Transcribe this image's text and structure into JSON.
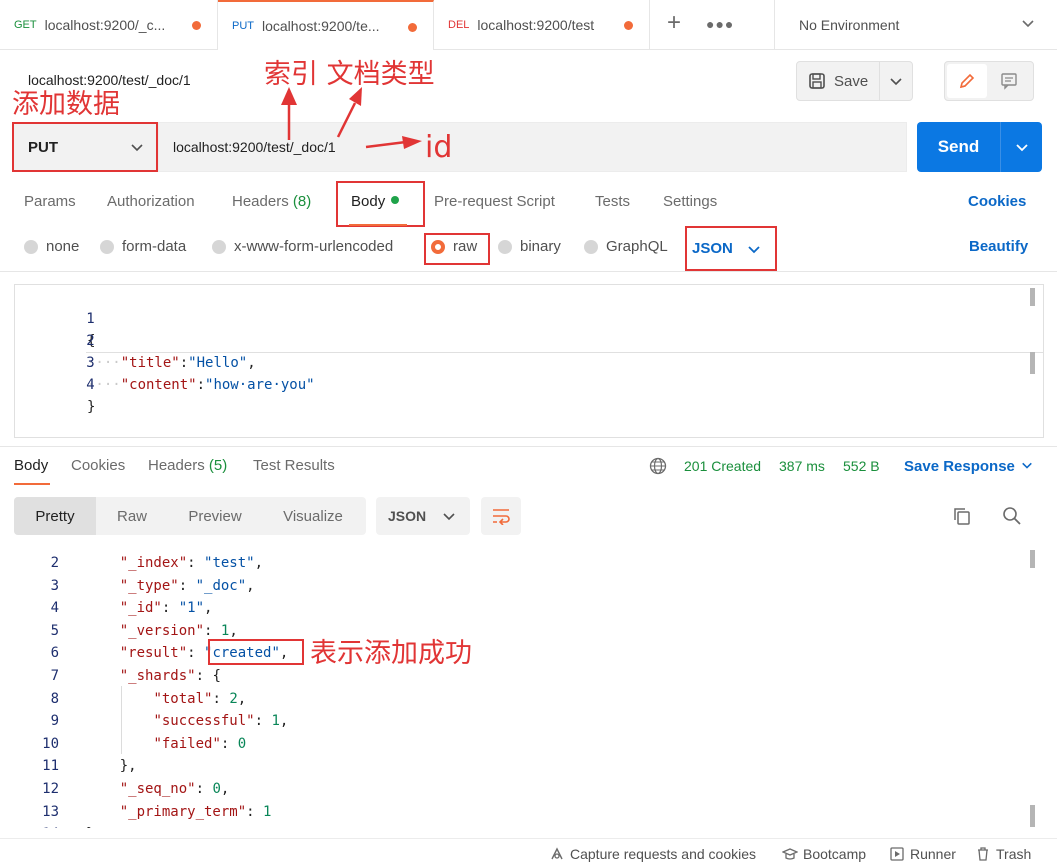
{
  "tabs": [
    {
      "method": "GET",
      "method_color": "#1a8f3c",
      "label": "localhost:9200/_c...",
      "unsaved": true
    },
    {
      "method": "PUT",
      "method_color": "#0b68c7",
      "label": "localhost:9200/te...",
      "unsaved": true,
      "active": true
    },
    {
      "method": "DEL",
      "method_color": "#e13535",
      "label": "localhost:9200/test",
      "unsaved": true
    }
  ],
  "environment": "No Environment",
  "request": {
    "title": "localhost:9200/test/_doc/1",
    "method": "PUT",
    "url": "localhost:9200/test/_doc/1",
    "save_label": "Save",
    "send_label": "Send"
  },
  "request_tabs": {
    "params": "Params",
    "authorization": "Authorization",
    "headers": "Headers",
    "headers_count": "(8)",
    "body": "Body",
    "pre_request": "Pre-request Script",
    "tests": "Tests",
    "settings": "Settings",
    "cookies": "Cookies"
  },
  "body_types": {
    "none": "none",
    "form_data": "form-data",
    "urlencoded": "x-www-form-urlencoded",
    "raw": "raw",
    "binary": "binary",
    "graphql": "GraphQL",
    "format": "JSON",
    "beautify": "Beautify"
  },
  "request_body_lines": [
    {
      "n": "1",
      "text": "{"
    },
    {
      "n": "2",
      "indent": "····",
      "key": "\"title\"",
      "sep": ":",
      "value": "\"Hello\"",
      "tail": ","
    },
    {
      "n": "3",
      "indent": "····",
      "key": "\"content\"",
      "sep": ":",
      "value": "\"how·are·you\"",
      "tail": ""
    },
    {
      "n": "4",
      "text": "}"
    }
  ],
  "response_tabs": {
    "body": "Body",
    "cookies": "Cookies",
    "headers": "Headers",
    "headers_count": "(5)",
    "test_results": "Test Results"
  },
  "response_status": {
    "status": "201 Created",
    "time": "387 ms",
    "size": "552 B",
    "save_response": "Save Response"
  },
  "response_views": {
    "pretty": "Pretty",
    "raw": "Raw",
    "preview": "Preview",
    "visualize": "Visualize",
    "format": "JSON"
  },
  "response_body_lines": [
    {
      "n": "2",
      "pre": "    ",
      "key": "\"_index\"",
      "sep": ": ",
      "value": "\"test\"",
      "vtype": "str",
      "tail": ","
    },
    {
      "n": "3",
      "pre": "    ",
      "key": "\"_type\"",
      "sep": ": ",
      "value": "\"_doc\"",
      "vtype": "str",
      "tail": ","
    },
    {
      "n": "4",
      "pre": "    ",
      "key": "\"_id\"",
      "sep": ": ",
      "value": "\"1\"",
      "vtype": "str",
      "tail": ","
    },
    {
      "n": "5",
      "pre": "    ",
      "key": "\"_version\"",
      "sep": ": ",
      "value": "1",
      "vtype": "num",
      "tail": ","
    },
    {
      "n": "6",
      "pre": "    ",
      "key": "\"result\"",
      "sep": ": ",
      "value": "\"created\"",
      "vtype": "str",
      "tail": ","
    },
    {
      "n": "7",
      "pre": "    ",
      "key": "\"_shards\"",
      "sep": ": ",
      "value": "{",
      "vtype": "plain",
      "tail": ""
    },
    {
      "n": "8",
      "pre": "        ",
      "key": "\"total\"",
      "sep": ": ",
      "value": "2",
      "vtype": "num",
      "tail": ","
    },
    {
      "n": "9",
      "pre": "        ",
      "key": "\"successful\"",
      "sep": ": ",
      "value": "1",
      "vtype": "num",
      "tail": ","
    },
    {
      "n": "10",
      "pre": "        ",
      "key": "\"failed\"",
      "sep": ": ",
      "value": "0",
      "vtype": "num",
      "tail": ""
    },
    {
      "n": "11",
      "pre": "    ",
      "key": "",
      "sep": "",
      "value": "},",
      "vtype": "plain",
      "tail": ""
    },
    {
      "n": "12",
      "pre": "    ",
      "key": "\"_seq_no\"",
      "sep": ": ",
      "value": "0",
      "vtype": "num",
      "tail": ","
    },
    {
      "n": "13",
      "pre": "    ",
      "key": "\"_primary_term\"",
      "sep": ": ",
      "value": "1",
      "vtype": "num",
      "tail": ""
    },
    {
      "n": "14",
      "pre": "",
      "key": "",
      "sep": "",
      "value": "}",
      "vtype": "plain",
      "tail": ""
    }
  ],
  "annotations": {
    "index_doctype": "索引 文档类型",
    "add_data": "添加数据",
    "id": "id",
    "success": "表示添加成功"
  },
  "statusbar": {
    "capture": "Capture requests and cookies",
    "bootcamp": "Bootcamp",
    "runner": "Runner",
    "trash": "Trash"
  },
  "colors": {
    "accent": "#f26b3a",
    "send": "#0b78e3",
    "link": "#0b68c7",
    "success": "#1a8f3c",
    "annotation": "#e13535"
  }
}
